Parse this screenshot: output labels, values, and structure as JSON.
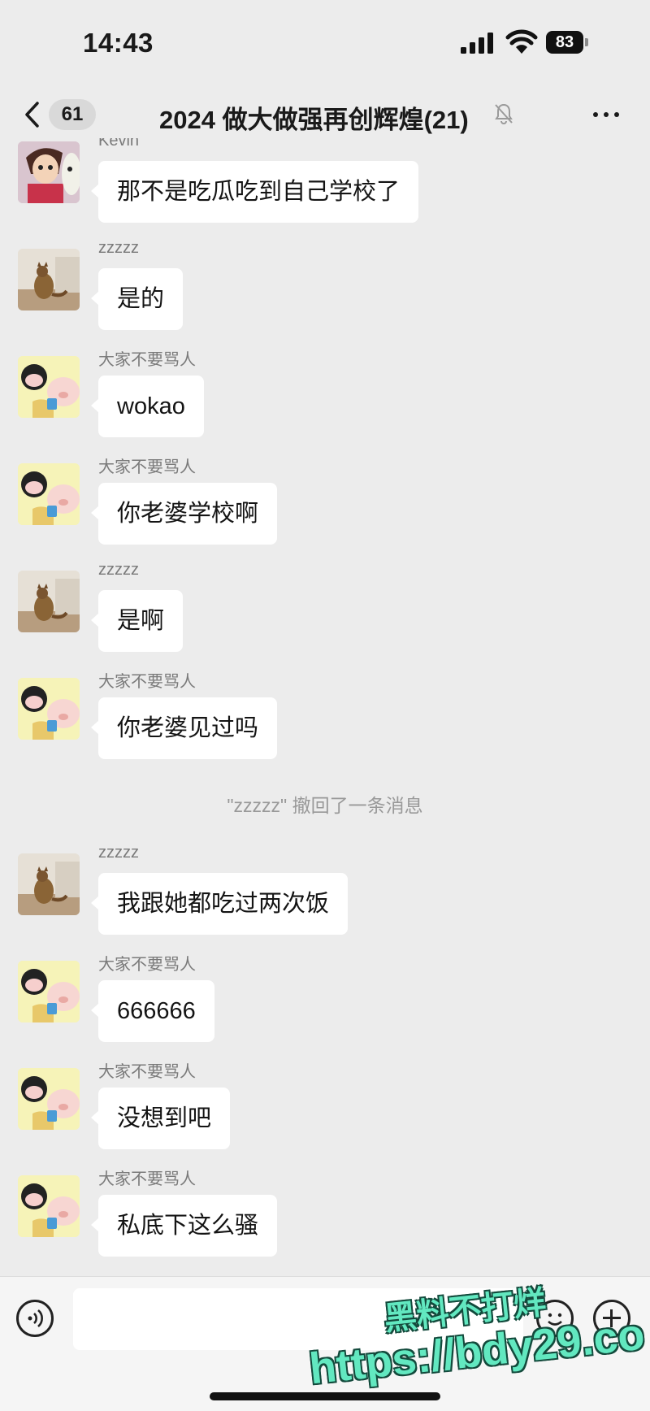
{
  "status_bar": {
    "time": "14:43",
    "battery": "83"
  },
  "nav": {
    "unread_count": "61",
    "title": "2024 做大做强再创辉煌(21)"
  },
  "messages": [
    {
      "type": "message",
      "sender": "Kevin",
      "avatar": "kevin-avatar",
      "text": "那不是吃瓜吃到自己学校了"
    },
    {
      "type": "message",
      "sender": "zzzzz",
      "avatar": "cat-avatar",
      "text": "是的"
    },
    {
      "type": "message",
      "sender": "大家不要骂人",
      "avatar": "pig-avatar",
      "text": "wokao"
    },
    {
      "type": "message",
      "sender": "大家不要骂人",
      "avatar": "pig-avatar",
      "text": "你老婆学校啊"
    },
    {
      "type": "message",
      "sender": "zzzzz",
      "avatar": "cat-avatar",
      "text": "是啊"
    },
    {
      "type": "message",
      "sender": "大家不要骂人",
      "avatar": "pig-avatar",
      "text": "你老婆见过吗"
    },
    {
      "type": "notice",
      "text": "\"zzzzz\" 撤回了一条消息"
    },
    {
      "type": "message",
      "sender": "zzzzz",
      "avatar": "cat-avatar",
      "text": "我跟她都吃过两次饭"
    },
    {
      "type": "message",
      "sender": "大家不要骂人",
      "avatar": "pig-avatar",
      "text": "666666"
    },
    {
      "type": "message",
      "sender": "大家不要骂人",
      "avatar": "pig-avatar",
      "text": "没想到吧"
    },
    {
      "type": "message",
      "sender": "大家不要骂人",
      "avatar": "pig-avatar",
      "text": "私底下这么骚"
    }
  ],
  "input": {
    "placeholder": ""
  },
  "watermark": {
    "line1": "黑料不打烊",
    "line2": "https://bdy29.co"
  }
}
